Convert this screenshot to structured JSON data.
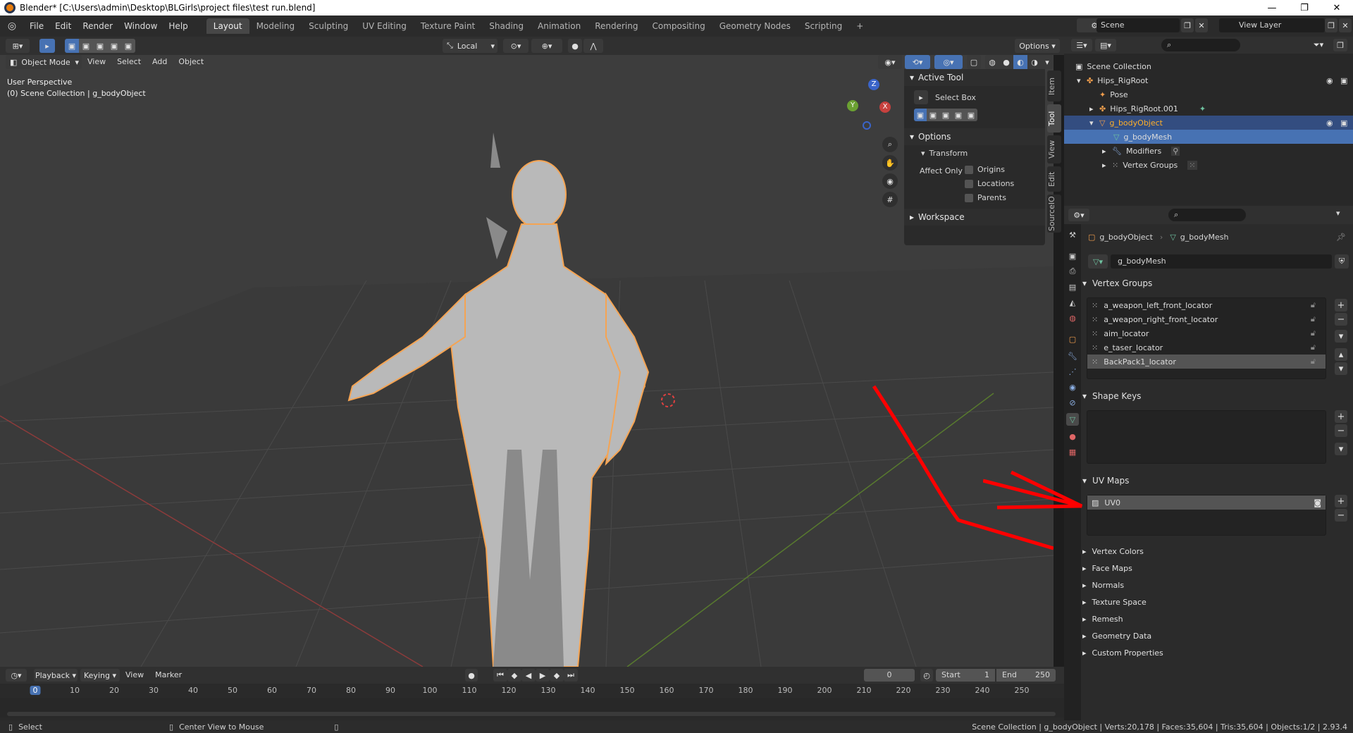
{
  "window": {
    "title": "Blender* [C:\\Users\\admin\\Desktop\\BLGirls\\project files\\test run.blend]",
    "minimize": "—",
    "maximize": "❐",
    "close": "✕"
  },
  "topbar": {
    "menus": [
      "File",
      "Edit",
      "Render",
      "Window",
      "Help"
    ],
    "workspaces": [
      "Layout",
      "Modeling",
      "Sculpting",
      "UV Editing",
      "Texture Paint",
      "Shading",
      "Animation",
      "Rendering",
      "Compositing",
      "Geometry Nodes",
      "Scripting"
    ],
    "add_tab": "+",
    "scene_label": "Scene",
    "view_layer_label": "View Layer"
  },
  "tool_header": {
    "orientation": "Local",
    "options": "Options"
  },
  "viewport_header": {
    "mode": "Object Mode",
    "menus": [
      "View",
      "Select",
      "Add",
      "Object"
    ]
  },
  "viewport": {
    "perspective": "User Perspective",
    "collection_info": "(0) Scene Collection | g_bodyObject",
    "gizmo_axes": [
      "Z",
      "Y",
      "X"
    ]
  },
  "npanel": {
    "tabs": [
      "Item",
      "Tool",
      "View",
      "Edit",
      "SourceIO"
    ],
    "active_tool_header": "Active Tool",
    "active_tool": "Select Box",
    "options_header": "Options",
    "transform_header": "Transform",
    "affect_only": "Affect Only",
    "checks": [
      "Origins",
      "Locations",
      "Parents"
    ],
    "workspace_header": "Workspace"
  },
  "timeline": {
    "menus": [
      "Playback",
      "Keying",
      "View",
      "Marker"
    ],
    "current_frame": "0",
    "start_label": "Start",
    "start_value": "1",
    "end_label": "End",
    "end_value": "250",
    "ruler": [
      "0",
      "10",
      "20",
      "30",
      "40",
      "50",
      "60",
      "70",
      "80",
      "90",
      "100",
      "110",
      "120",
      "130",
      "140",
      "150",
      "160",
      "170",
      "180",
      "190",
      "200",
      "210",
      "220",
      "230",
      "240",
      "250"
    ]
  },
  "statusbar": {
    "left_action": "Select",
    "middle_action": "Center View to Mouse",
    "stats": "Scene Collection | g_bodyObject | Verts:20,178 | Faces:35,604 | Tris:35,604 | Objects:1/2 | 2.93.4"
  },
  "outliner": {
    "root": "Scene Collection",
    "items": [
      {
        "label": "Hips_RigRoot",
        "icon": "armature-icon"
      },
      {
        "label": "Pose",
        "icon": "pose-icon"
      },
      {
        "label": "Hips_RigRoot.001",
        "icon": "armature-icon"
      },
      {
        "label": "g_bodyObject",
        "icon": "mesh-object-icon"
      },
      {
        "label": "g_bodyMesh",
        "icon": "mesh-data-icon"
      },
      {
        "label": "Modifiers",
        "icon": "wrench-icon"
      },
      {
        "label": "Vertex Groups",
        "icon": "vertex-groups-icon"
      }
    ]
  },
  "properties": {
    "breadcrumb_object": "g_bodyObject",
    "breadcrumb_mesh": "g_bodyMesh",
    "datablock_name": "g_bodyMesh",
    "vertex_groups_header": "Vertex Groups",
    "vertex_groups": [
      "a_weapon_left_front_locator",
      "a_weapon_right_front_locator",
      "aim_locator",
      "e_taser_locator",
      "BackPack1_locator"
    ],
    "shape_keys_header": "Shape Keys",
    "uv_maps_header": "UV Maps",
    "uv_maps": [
      "UV0"
    ],
    "collapsed_sections": [
      "Vertex Colors",
      "Face Maps",
      "Normals",
      "Texture Space",
      "Remesh",
      "Geometry Data",
      "Custom Properties"
    ]
  },
  "colors": {
    "accent_blue": "#4772b3",
    "selection_orange": "#f5a453",
    "annotation_red": "#ff0000",
    "axis_red": "#8c3b3b",
    "axis_green": "#587a2e"
  }
}
